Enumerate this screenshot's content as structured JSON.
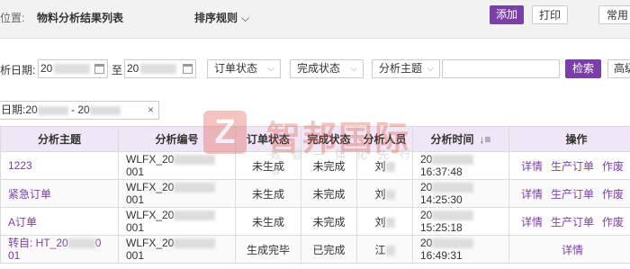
{
  "header": {
    "location_label": "位置:",
    "title": "物料分析结果列表",
    "sort_menu_label": "排序规则",
    "add_label": "添加",
    "print_label": "打印",
    "common_label": "常用"
  },
  "filters": {
    "date_label": "析日期:",
    "date_from": "20",
    "date_to_sep": "至",
    "date_to": "20",
    "order_status": "订单状态",
    "complete_status": "完成状态",
    "analysis_theme": "分析主题",
    "search_label": "检索",
    "advanced_label": "高级"
  },
  "active_filter": {
    "text_prefix": "日期:20",
    "text_mid": " - 20"
  },
  "table": {
    "columns": [
      "分析主题",
      "分析编号",
      "订单状态",
      "完成状态",
      "分析人员",
      "分析时间",
      "操作"
    ],
    "rows": [
      {
        "theme": "1223",
        "code_prefix": "WLFX_20",
        "code_suffix": "001",
        "order_status": "未生成",
        "complete_status": "未完成",
        "person": "刘",
        "time_prefix": "20",
        "time": "16:37:48",
        "actions": [
          "详情",
          "生产订单",
          "作废"
        ]
      },
      {
        "theme": "紧急订单",
        "code_prefix": "WLFX_20",
        "code_suffix": "001",
        "order_status": "未生成",
        "complete_status": "未完成",
        "person": "刘",
        "time_prefix": "20",
        "time": "14:25:30",
        "actions": [
          "详情",
          "生产订单",
          "作废"
        ]
      },
      {
        "theme": "A订单",
        "code_prefix": "WLFX_20",
        "code_suffix": "001",
        "order_status": "未生成",
        "complete_status": "未完成",
        "person": "刘",
        "time_prefix": "20",
        "time": "15:25:18",
        "actions": [
          "详情",
          "生产订单",
          "作废"
        ]
      },
      {
        "theme": "转自: HT_20",
        "theme_line2": "01",
        "theme_suffix": "0",
        "code_prefix": "WLFX_20",
        "code_suffix": "001",
        "order_status": "生成完毕",
        "complete_status": "已完成",
        "person": "江",
        "time_prefix": "20",
        "time": "16:49:31",
        "actions": [
          "详情"
        ]
      }
    ]
  },
  "watermark": {
    "logo_char": "Z",
    "name": "智邦国际",
    "tagline": "数智一体化先行者"
  },
  "colors": {
    "accent": "#7b3fa8",
    "header_bg": "#f0e6f5"
  }
}
